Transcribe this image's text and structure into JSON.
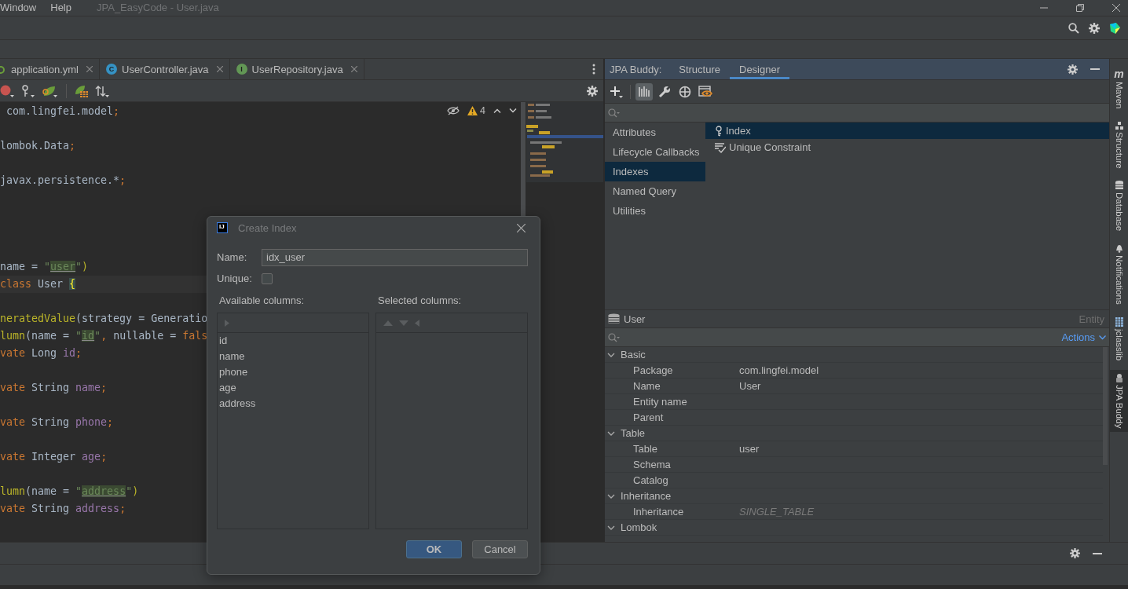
{
  "menu_bar": {
    "menus": [
      {
        "label": "Window"
      },
      {
        "label": "Help"
      }
    ],
    "title": "JPA_EasyCode - User.java"
  },
  "editor": {
    "tabs": [
      {
        "label": "application.yml",
        "selected": false
      },
      {
        "label": "UserController.java",
        "badge": "C",
        "selected": false
      },
      {
        "label": "UserRepository.java",
        "badge": "I",
        "selected": false
      }
    ],
    "warnings": "4",
    "lines": [
      {
        "kind": "code",
        "tokens": [
          {
            "text": " com.lingfei.model",
            "kind": "plain"
          },
          {
            "text": ";",
            "kind": "keyword"
          }
        ]
      },
      {
        "kind": "blank"
      },
      {
        "kind": "code",
        "tokens": [
          {
            "text": "lombok.Data",
            "kind": "plain"
          },
          {
            "text": ";",
            "kind": "keyword"
          }
        ]
      },
      {
        "kind": "blank"
      },
      {
        "kind": "code",
        "tokens": [
          {
            "text": "javax.persistence.*",
            "kind": "plain"
          },
          {
            "text": ";",
            "kind": "keyword"
          }
        ]
      },
      {
        "kind": "blank"
      },
      {
        "kind": "blank"
      },
      {
        "kind": "blank"
      },
      {
        "kind": "blank"
      },
      {
        "kind": "code",
        "tokens": [
          {
            "text": "name = ",
            "kind": "plain"
          },
          {
            "text": "\"",
            "kind": "string"
          },
          {
            "text": "user",
            "kind": "match"
          },
          {
            "text": "\"",
            "kind": "string"
          },
          {
            "text": ")",
            "kind": "annotation"
          }
        ]
      },
      {
        "kind": "current",
        "tokens": [
          {
            "text": "class",
            "kind": "keyword"
          },
          {
            "text": " User ",
            "kind": "plain"
          },
          {
            "text": "{",
            "kind": "brace"
          }
        ]
      },
      {
        "kind": "blank"
      },
      {
        "kind": "code",
        "tokens": [
          {
            "text": "neratedValue",
            "kind": "annotation"
          },
          {
            "text": "(strategy = Generatio",
            "kind": "plain"
          }
        ]
      },
      {
        "kind": "code",
        "tokens": [
          {
            "text": "lumn",
            "kind": "annotation"
          },
          {
            "text": "(name = ",
            "kind": "plain"
          },
          {
            "text": "\"",
            "kind": "string"
          },
          {
            "text": "id",
            "kind": "match"
          },
          {
            "text": "\"",
            "kind": "string"
          },
          {
            "text": ", ",
            "kind": "keyword"
          },
          {
            "text": "nullable = ",
            "kind": "plain"
          },
          {
            "text": "fals",
            "kind": "keyword"
          }
        ]
      },
      {
        "kind": "code",
        "tokens": [
          {
            "text": "vate",
            "kind": "keyword"
          },
          {
            "text": " Long ",
            "kind": "plain"
          },
          {
            "text": "id",
            "kind": "field"
          },
          {
            "text": ";",
            "kind": "keyword"
          }
        ]
      },
      {
        "kind": "blank"
      },
      {
        "kind": "code",
        "tokens": [
          {
            "text": "vate",
            "kind": "keyword"
          },
          {
            "text": " String ",
            "kind": "plain"
          },
          {
            "text": "name",
            "kind": "field"
          },
          {
            "text": ";",
            "kind": "keyword"
          }
        ]
      },
      {
        "kind": "blank"
      },
      {
        "kind": "code",
        "tokens": [
          {
            "text": "vate",
            "kind": "keyword"
          },
          {
            "text": " String ",
            "kind": "plain"
          },
          {
            "text": "phone",
            "kind": "field"
          },
          {
            "text": ";",
            "kind": "keyword"
          }
        ]
      },
      {
        "kind": "blank"
      },
      {
        "kind": "code",
        "tokens": [
          {
            "text": "vate",
            "kind": "keyword"
          },
          {
            "text": " Integer ",
            "kind": "plain"
          },
          {
            "text": "age",
            "kind": "field"
          },
          {
            "text": ";",
            "kind": "keyword"
          }
        ]
      },
      {
        "kind": "blank"
      },
      {
        "kind": "code",
        "tokens": [
          {
            "text": "lumn",
            "kind": "annotation"
          },
          {
            "text": "(name = ",
            "kind": "plain"
          },
          {
            "text": "\"",
            "kind": "string"
          },
          {
            "text": "address",
            "kind": "match"
          },
          {
            "text": "\"",
            "kind": "string"
          },
          {
            "text": ")",
            "kind": "annotation"
          }
        ]
      },
      {
        "kind": "code",
        "tokens": [
          {
            "text": "vate",
            "kind": "keyword"
          },
          {
            "text": " String ",
            "kind": "plain"
          },
          {
            "text": "address",
            "kind": "field"
          },
          {
            "text": ";",
            "kind": "keyword"
          }
        ]
      }
    ]
  },
  "jpa_buddy": {
    "label": "JPA Buddy:",
    "tabs": [
      {
        "label": "Structure",
        "selected": false
      },
      {
        "label": "Designer",
        "selected": true
      }
    ],
    "toolbar": [
      {
        "kind": "add",
        "selected": false
      },
      {
        "kind": "bars",
        "selected": true
      },
      {
        "kind": "wrench",
        "selected": false
      },
      {
        "kind": "target",
        "selected": false
      },
      {
        "kind": "preview",
        "selected": false
      }
    ],
    "categories": [
      {
        "label": "Attributes",
        "selected": false
      },
      {
        "label": "Lifecycle Callbacks",
        "selected": false
      },
      {
        "label": "Indexes",
        "selected": true
      },
      {
        "label": "Named Query",
        "selected": false
      },
      {
        "label": "Utilities",
        "selected": false
      }
    ],
    "items": [
      {
        "label": "Index",
        "selected": true
      },
      {
        "label": "Unique Constraint",
        "selected": false
      }
    ],
    "entity": {
      "name": "User",
      "type": "Entity",
      "actions": "Actions",
      "groups": [
        {
          "label": "Basic",
          "expanded": true,
          "children": [
            {
              "label": "Package",
              "value": "com.lingfei.model",
              "default": false
            },
            {
              "label": "Name",
              "value": "User",
              "default": false
            },
            {
              "label": "Entity name"
            },
            {
              "label": "Parent"
            }
          ]
        },
        {
          "label": "Table",
          "expanded": true,
          "children": [
            {
              "label": "Table",
              "value": "user",
              "default": false
            },
            {
              "label": "Schema"
            },
            {
              "label": "Catalog"
            }
          ]
        },
        {
          "label": "Inheritance",
          "expanded": true,
          "children": [
            {
              "label": "Inheritance",
              "value": "SINGLE_TABLE",
              "default": true
            }
          ]
        },
        {
          "label": "Lombok",
          "expanded": true
        }
      ]
    }
  },
  "side_tabs": [
    {
      "label": "Maven",
      "glyph": "m",
      "selected": false
    },
    {
      "label": "Structure",
      "selected": false
    },
    {
      "label": "Database",
      "selected": false
    },
    {
      "label": "Notifications",
      "selected": false
    },
    {
      "label": "jclasslib",
      "selected": false
    },
    {
      "label": "JPA Buddy",
      "selected": true
    }
  ],
  "dialog": {
    "logo": "IJ",
    "title": "Create Index",
    "name_label": "Name:",
    "name_value": "idx_user",
    "unique_label": "Unique:",
    "unique_checked": false,
    "available_label": "Available columns:",
    "selected_label": "Selected columns:",
    "available": [
      {
        "label": "id"
      },
      {
        "label": "name"
      },
      {
        "label": "phone"
      },
      {
        "label": "age"
      },
      {
        "label": "address"
      }
    ],
    "buttons": [
      {
        "label": "OK",
        "default": true
      },
      {
        "label": "Cancel",
        "default": false
      }
    ]
  }
}
